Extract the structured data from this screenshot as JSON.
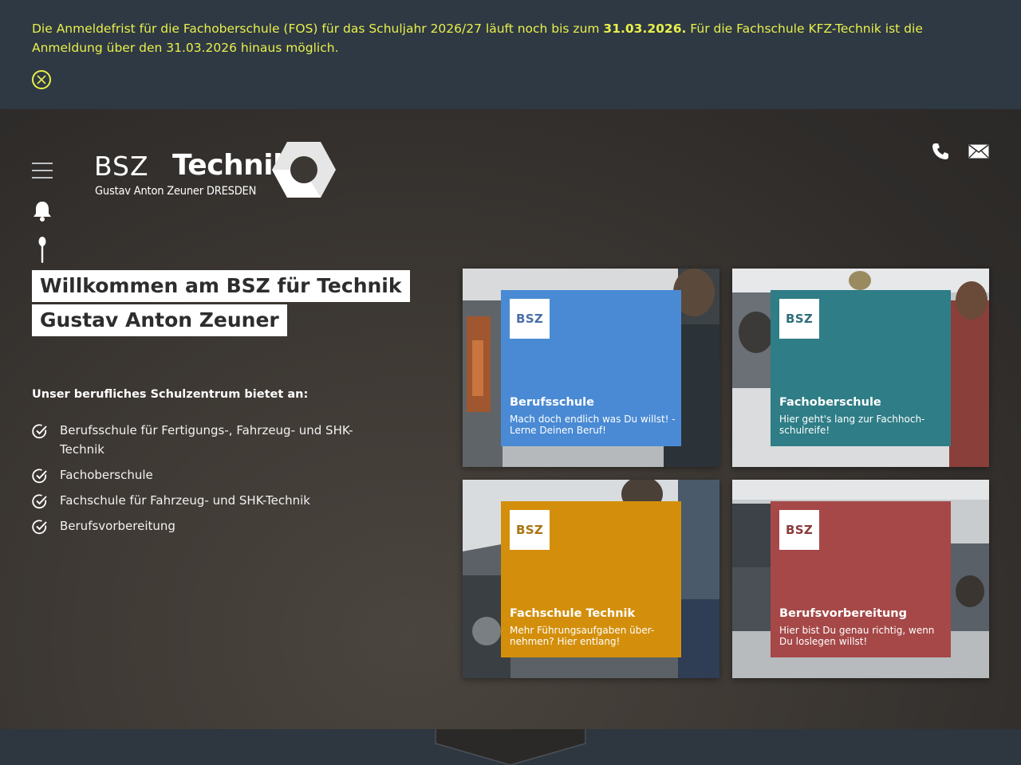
{
  "notice": {
    "text_part1": "Die Anmeldefrist für die Fachoberschule (FOS) für das Schuljahr 2026/27 läuft noch bis zum ",
    "deadline": "31.03.2026.",
    "text_part2": " Für die Fachschule KFZ-Technik ist die Anmeldung über den 31.03.2026 hinaus möglich.",
    "color": "#e8f04a"
  },
  "logo": {
    "bsz": "BSZ",
    "technik": "Technik",
    "sub": "Gustav Anton Zeuner DRESDEN"
  },
  "hero": {
    "title_line1": "Willkommen am BSZ für Technik",
    "title_line2": "Gustav Anton Zeuner",
    "offers_heading": "Unser berufliches Schulzentrum bietet an:",
    "offers": [
      "Berufsschule für Fertigungs-, Fahrzeug- und SHK-Technik",
      "Fachoberschule",
      "Fachschule für Fahrzeug- und SHK-Technik",
      "Berufsvorbereitung"
    ]
  },
  "tiles": [
    {
      "badge": "BSZ",
      "title": "Berufsschule",
      "text": "Mach doch endlich was Du willst! - Lerne Deinen Beruf!",
      "color": "#4a8ad4"
    },
    {
      "badge": "BSZ",
      "title": "Fachoberschule",
      "text": "Hier geht's lang zur Fachhoch-schulreife!",
      "color": "#2f7d86"
    },
    {
      "badge": "BSZ",
      "title": "Fachschule Technik",
      "text": "Mehr Führungsaufgaben über-nehmen? Hier entlang!",
      "color": "#d38f0c"
    },
    {
      "badge": "BSZ",
      "title": "Berufsvorbereitung",
      "text": "Hier bist Du genau richtig, wenn Du loslegen willst!",
      "color": "#a64848"
    }
  ],
  "icons": {
    "close": "close-circle-icon",
    "menu": "hamburger-menu-icon",
    "bell": "bell-icon",
    "spoon": "spoon-icon",
    "phone": "phone-icon",
    "mail": "mail-icon",
    "check": "check-circle-icon"
  }
}
